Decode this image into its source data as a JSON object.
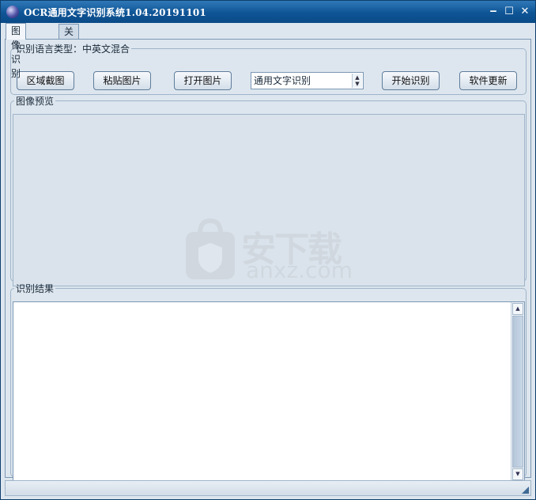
{
  "window": {
    "title": "OCR通用文字识别系统1.04.20191101"
  },
  "tabs": [
    {
      "label": "图像识别",
      "active": true
    },
    {
      "label": "关于",
      "active": false
    }
  ],
  "toolbar_group": {
    "legend": "识别语言类型：中英文混合",
    "buttons": {
      "region_capture": "区域截图",
      "paste_image": "粘贴图片",
      "open_image": "打开图片",
      "start_recognize": "开始识别",
      "software_update": "软件更新"
    },
    "mode_select": {
      "value": "通用文字识别"
    }
  },
  "preview": {
    "legend": "图像预览"
  },
  "result": {
    "legend": "识别结果",
    "text": ""
  },
  "watermark": {
    "zh": "安下载",
    "en": "anxz.com"
  },
  "colors": {
    "titlebar": "#0f5596",
    "panel": "#dde6ee",
    "border": "#7c97b4"
  }
}
